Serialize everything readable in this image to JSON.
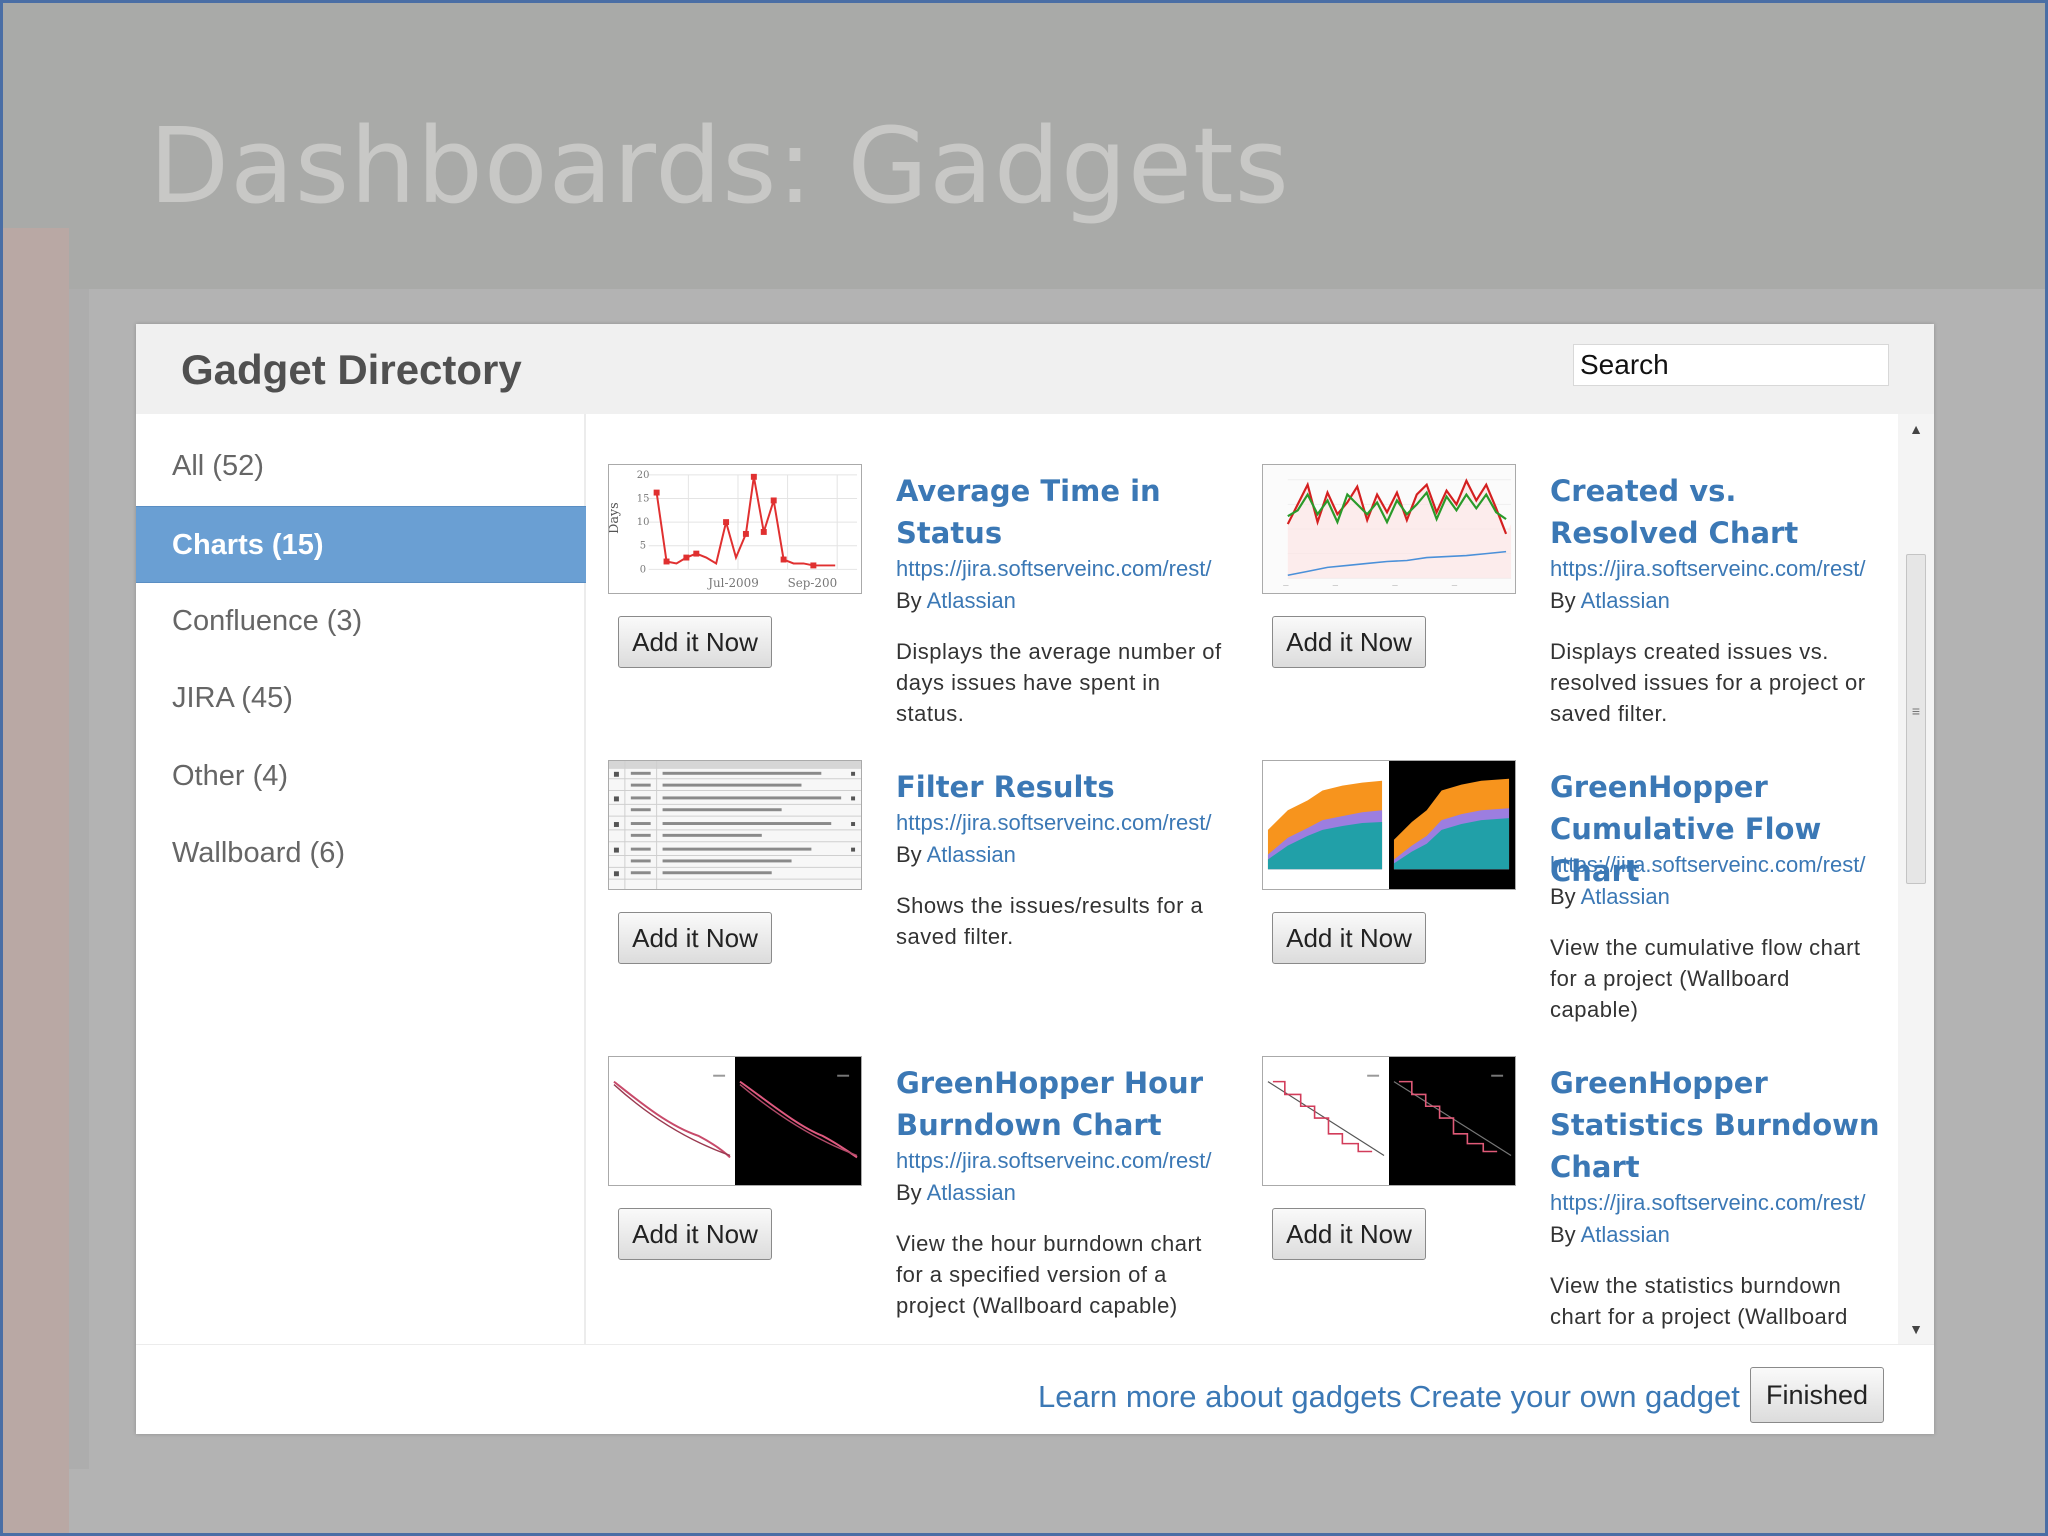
{
  "slide": {
    "title": "Dashboards: Gadgets"
  },
  "dialog": {
    "title": "Gadget Directory",
    "search": {
      "placeholder": "Search",
      "value": ""
    }
  },
  "categories": [
    {
      "label": "All (52)",
      "active": false
    },
    {
      "label": "Charts (15)",
      "active": true
    },
    {
      "label": "Confluence (3)",
      "active": false
    },
    {
      "label": "JIRA (45)",
      "active": false
    },
    {
      "label": "Other (4)",
      "active": false
    },
    {
      "label": "Wallboard (6)",
      "active": false
    }
  ],
  "gadgets": [
    {
      "title": "Average Time in Status",
      "url": "https://jira.softserveinc.com/rest/",
      "by_prefix": "By",
      "author": "Atlassian",
      "description": "Displays the average number of days issues have spent in status.",
      "button": "Add it Now",
      "thumb": {
        "ylabel": "Days",
        "yticks": [
          "20",
          "15",
          "10",
          "5",
          "0"
        ],
        "xticks": [
          "Jul-2009",
          "Sep-200"
        ]
      }
    },
    {
      "title": "Created vs. Resolved Chart",
      "url": "https://jira.softserveinc.com/rest/",
      "by_prefix": "By",
      "author": "Atlassian",
      "description": "Displays created issues vs. resolved issues for a project or saved filter.",
      "button": "Add it Now"
    },
    {
      "title": "Filter Results",
      "url": "https://jira.softserveinc.com/rest/",
      "by_prefix": "By",
      "author": "Atlassian",
      "description": "Shows the issues/results for a saved filter.",
      "button": "Add it Now"
    },
    {
      "title": "GreenHopper Cumulative Flow Chart",
      "url": "https://jira.softserveinc.com/rest/",
      "by_prefix": "By",
      "author": "Atlassian",
      "description": "View the cumulative flow chart for a project (Wallboard capable)",
      "button": "Add it Now"
    },
    {
      "title": "GreenHopper Hour Burndown Chart",
      "url": "https://jira.softserveinc.com/rest/",
      "by_prefix": "By",
      "author": "Atlassian",
      "description": "View the hour burndown chart for a specified version of a project (Wallboard capable)",
      "button": "Add it Now"
    },
    {
      "title": "GreenHopper Statistics Burndown Chart",
      "url": "https://jira.softserveinc.com/rest/",
      "by_prefix": "By",
      "author": "Atlassian",
      "description": "View the statistics burndown chart for a project (Wallboard",
      "button": "Add it Now"
    }
  ],
  "footer": {
    "learn_more": "Learn more about gadgets",
    "create_own": "Create your own gadget",
    "finished": "Finished"
  },
  "colors": {
    "accent": "#6a9fd3",
    "link": "#3b78b5"
  }
}
